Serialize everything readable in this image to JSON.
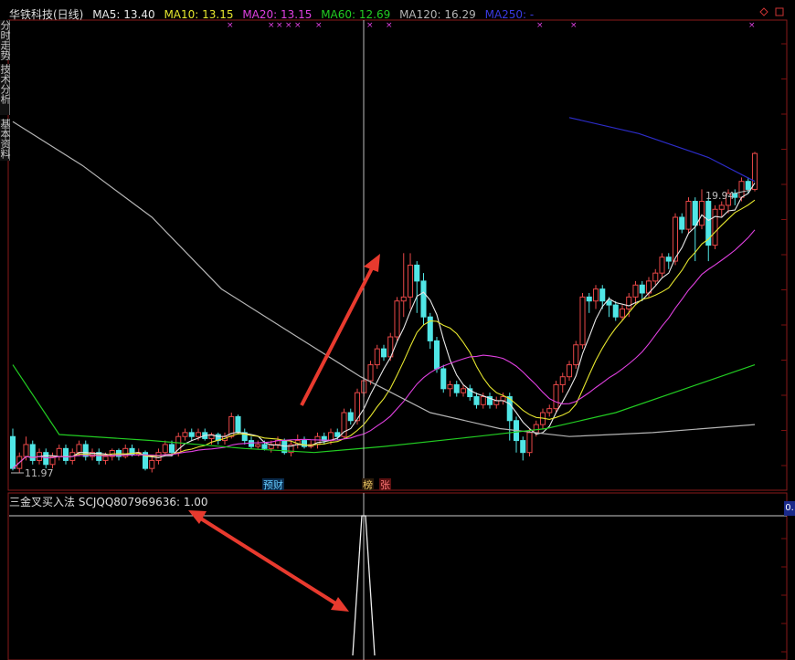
{
  "header": {
    "name": "华铁科技(日线)",
    "ma5": "MA5: 13.40",
    "ma10": "MA10: 13.15",
    "ma20": "MA20: 13.15",
    "ma60": "MA60: 12.69",
    "ma120": "MA120: 16.29",
    "ma250": "MA250: -"
  },
  "colors": {
    "ma5": "#e8e8e8",
    "ma10": "#e6e62e",
    "ma20": "#e040e0",
    "ma60": "#22cc22",
    "ma120": "#b4b4b4",
    "ma250": "#2c2cc8",
    "up": "#e84848",
    "down": "#50e6e6",
    "grid": "#7a1010",
    "annotation_arrow": "#e83a2e"
  },
  "side_tabs": [
    "分时走势",
    "技术分析",
    "基本资料"
  ],
  "indicator": {
    "title": "三金叉买入法",
    "value_text": "SCJQQ807969636: 1.00",
    "right_value": "0."
  },
  "chart_data": {
    "type": "candlestick",
    "ylim": [
      11.5,
      23.2
    ],
    "price_labels": {
      "high": "19.94",
      "low": "11.97"
    },
    "event_labels": [
      "预",
      "财",
      "榜",
      "张"
    ],
    "candles": [
      [
        12.8,
        12.0,
        13.0,
        11.95
      ],
      [
        12.0,
        12.3,
        12.4,
        11.9
      ],
      [
        12.3,
        12.6,
        12.8,
        12.2
      ],
      [
        12.6,
        12.2,
        12.7,
        12.1
      ],
      [
        12.2,
        12.4,
        12.5,
        12.1
      ],
      [
        12.4,
        12.1,
        12.5,
        12.0
      ],
      [
        12.1,
        12.3,
        12.4,
        12.0
      ],
      [
        12.3,
        12.5,
        12.6,
        12.2
      ],
      [
        12.5,
        12.2,
        12.6,
        12.1
      ],
      [
        12.2,
        12.4,
        12.5,
        12.1
      ],
      [
        12.4,
        12.6,
        12.7,
        12.3
      ],
      [
        12.6,
        12.3,
        12.7,
        12.2
      ],
      [
        12.3,
        12.4,
        12.5,
        12.2
      ],
      [
        12.4,
        12.2,
        12.5,
        12.1
      ],
      [
        12.2,
        12.3,
        12.4,
        12.1
      ],
      [
        12.3,
        12.45,
        12.5,
        12.2
      ],
      [
        12.45,
        12.3,
        12.5,
        12.2
      ],
      [
        12.3,
        12.5,
        12.6,
        12.25
      ],
      [
        12.5,
        12.35,
        12.6,
        12.3
      ],
      [
        12.35,
        12.4,
        12.5,
        12.3
      ],
      [
        12.4,
        12.0,
        12.45,
        11.95
      ],
      [
        12.0,
        12.2,
        12.3,
        11.9
      ],
      [
        12.2,
        12.4,
        12.5,
        12.1
      ],
      [
        12.4,
        12.6,
        12.7,
        12.3
      ],
      [
        12.6,
        12.4,
        12.7,
        12.3
      ],
      [
        12.4,
        12.8,
        12.9,
        12.3
      ],
      [
        12.8,
        12.9,
        13.0,
        12.7
      ],
      [
        12.9,
        12.8,
        13.0,
        12.7
      ],
      [
        12.8,
        12.9,
        13.0,
        12.7
      ],
      [
        12.9,
        12.75,
        13.0,
        12.7
      ],
      [
        12.75,
        12.85,
        12.9,
        12.6
      ],
      [
        12.85,
        12.7,
        12.9,
        12.6
      ],
      [
        12.7,
        12.8,
        12.9,
        12.6
      ],
      [
        12.8,
        13.3,
        13.4,
        12.75
      ],
      [
        13.3,
        12.9,
        13.35,
        12.85
      ],
      [
        12.9,
        12.7,
        13.0,
        12.6
      ],
      [
        12.7,
        12.55,
        12.8,
        12.5
      ],
      [
        12.55,
        12.6,
        12.7,
        12.5
      ],
      [
        12.6,
        12.5,
        12.7,
        12.45
      ],
      [
        12.5,
        12.6,
        12.7,
        12.4
      ],
      [
        12.6,
        12.7,
        12.8,
        12.5
      ],
      [
        12.7,
        12.4,
        12.75,
        12.35
      ],
      [
        12.4,
        12.6,
        12.7,
        12.3
      ],
      [
        12.6,
        12.7,
        12.85,
        12.5
      ],
      [
        12.7,
        12.55,
        12.8,
        12.5
      ],
      [
        12.55,
        12.6,
        12.7,
        12.5
      ],
      [
        12.6,
        12.8,
        12.9,
        12.5
      ],
      [
        12.8,
        12.7,
        12.9,
        12.6
      ],
      [
        12.7,
        12.9,
        13.0,
        12.6
      ],
      [
        12.9,
        12.8,
        13.0,
        12.7
      ],
      [
        12.8,
        13.4,
        13.5,
        12.75
      ],
      [
        13.4,
        13.2,
        13.5,
        13.1
      ],
      [
        13.2,
        13.9,
        14.0,
        13.1
      ],
      [
        13.9,
        14.2,
        14.3,
        13.8
      ],
      [
        14.2,
        14.6,
        14.7,
        14.1
      ],
      [
        14.6,
        15.0,
        15.1,
        14.5
      ],
      [
        15.0,
        14.8,
        15.1,
        14.7
      ],
      [
        14.8,
        15.3,
        15.4,
        14.7
      ],
      [
        15.3,
        16.2,
        16.3,
        15.2
      ],
      [
        16.2,
        16.3,
        17.4,
        15.8
      ],
      [
        16.3,
        17.1,
        17.4,
        16.0
      ],
      [
        17.1,
        16.7,
        17.2,
        15.9
      ],
      [
        16.7,
        15.8,
        16.9,
        15.6
      ],
      [
        15.8,
        15.2,
        15.9,
        15.0
      ],
      [
        15.2,
        14.5,
        15.3,
        14.4
      ],
      [
        14.5,
        14.0,
        14.6,
        13.9
      ],
      [
        14.0,
        14.1,
        14.2,
        13.8
      ],
      [
        14.1,
        13.9,
        14.2,
        13.8
      ],
      [
        13.9,
        14.0,
        14.1,
        13.8
      ],
      [
        14.0,
        13.8,
        14.1,
        13.7
      ],
      [
        13.8,
        13.6,
        13.9,
        13.5
      ],
      [
        13.6,
        13.8,
        13.9,
        13.5
      ],
      [
        13.8,
        13.6,
        13.9,
        13.5
      ],
      [
        13.6,
        13.7,
        13.8,
        13.5
      ],
      [
        13.7,
        13.8,
        13.9,
        13.6
      ],
      [
        13.8,
        13.2,
        13.9,
        12.7
      ],
      [
        13.2,
        12.7,
        13.3,
        12.4
      ],
      [
        12.7,
        12.4,
        12.8,
        12.2
      ],
      [
        12.4,
        12.9,
        13.0,
        12.3
      ],
      [
        12.9,
        13.1,
        13.2,
        12.8
      ],
      [
        13.1,
        13.4,
        13.5,
        13.0
      ],
      [
        13.4,
        13.5,
        13.6,
        13.3
      ],
      [
        13.5,
        14.1,
        14.2,
        13.4
      ],
      [
        14.1,
        14.3,
        14.4,
        13.9
      ],
      [
        14.3,
        14.6,
        14.7,
        14.2
      ],
      [
        14.6,
        15.1,
        15.2,
        14.5
      ],
      [
        15.1,
        16.3,
        16.4,
        15.0
      ],
      [
        16.3,
        16.2,
        16.4,
        15.9
      ],
      [
        16.2,
        16.5,
        16.6,
        16.0
      ],
      [
        16.5,
        16.2,
        16.6,
        16.0
      ],
      [
        16.2,
        16.1,
        16.3,
        15.8
      ],
      [
        16.1,
        15.8,
        16.2,
        15.7
      ],
      [
        15.8,
        16.0,
        16.1,
        15.7
      ],
      [
        16.0,
        16.3,
        16.4,
        15.8
      ],
      [
        16.3,
        16.6,
        16.7,
        16.1
      ],
      [
        16.6,
        16.4,
        16.7,
        16.2
      ],
      [
        16.4,
        16.7,
        16.8,
        16.3
      ],
      [
        16.7,
        16.9,
        17.0,
        16.6
      ],
      [
        16.9,
        17.3,
        17.4,
        16.8
      ],
      [
        17.3,
        17.2,
        17.4,
        17.0
      ],
      [
        17.2,
        18.3,
        18.4,
        17.1
      ],
      [
        18.3,
        18.0,
        18.4,
        17.9
      ],
      [
        18.0,
        18.7,
        18.8,
        17.9
      ],
      [
        18.7,
        18.1,
        18.8,
        17.2
      ],
      [
        18.1,
        18.7,
        19.0,
        18.0
      ],
      [
        18.7,
        17.6,
        18.8,
        17.2
      ],
      [
        17.6,
        18.5,
        18.6,
        17.5
      ],
      [
        18.5,
        18.6,
        18.7,
        18.3
      ],
      [
        18.6,
        18.9,
        19.0,
        18.4
      ],
      [
        18.9,
        18.8,
        19.0,
        18.6
      ],
      [
        18.8,
        19.2,
        19.3,
        18.7
      ],
      [
        19.2,
        19.0,
        19.3,
        18.9
      ],
      [
        19.0,
        19.9,
        19.94,
        18.95
      ]
    ],
    "ma120": [
      [
        0,
        20.7
      ],
      [
        15,
        19.6
      ],
      [
        30,
        18.3
      ],
      [
        45,
        16.5
      ],
      [
        60,
        15.4
      ],
      [
        75,
        14.3
      ],
      [
        90,
        13.4
      ],
      [
        105,
        13.0
      ],
      [
        120,
        12.8
      ],
      [
        138,
        12.9
      ],
      [
        160,
        13.1
      ]
    ],
    "ma60": [
      [
        0,
        14.6
      ],
      [
        10,
        12.85
      ],
      [
        30,
        12.7
      ],
      [
        50,
        12.5
      ],
      [
        65,
        12.4
      ],
      [
        80,
        12.55
      ],
      [
        100,
        12.8
      ],
      [
        115,
        13.0
      ],
      [
        130,
        13.4
      ],
      [
        145,
        14.0
      ],
      [
        160,
        14.6
      ]
    ],
    "ma250": [
      [
        120,
        20.8
      ],
      [
        135,
        20.4
      ],
      [
        150,
        19.8
      ],
      [
        160,
        19.2
      ]
    ],
    "signal": {
      "x": 75,
      "value": 1.0
    }
  }
}
